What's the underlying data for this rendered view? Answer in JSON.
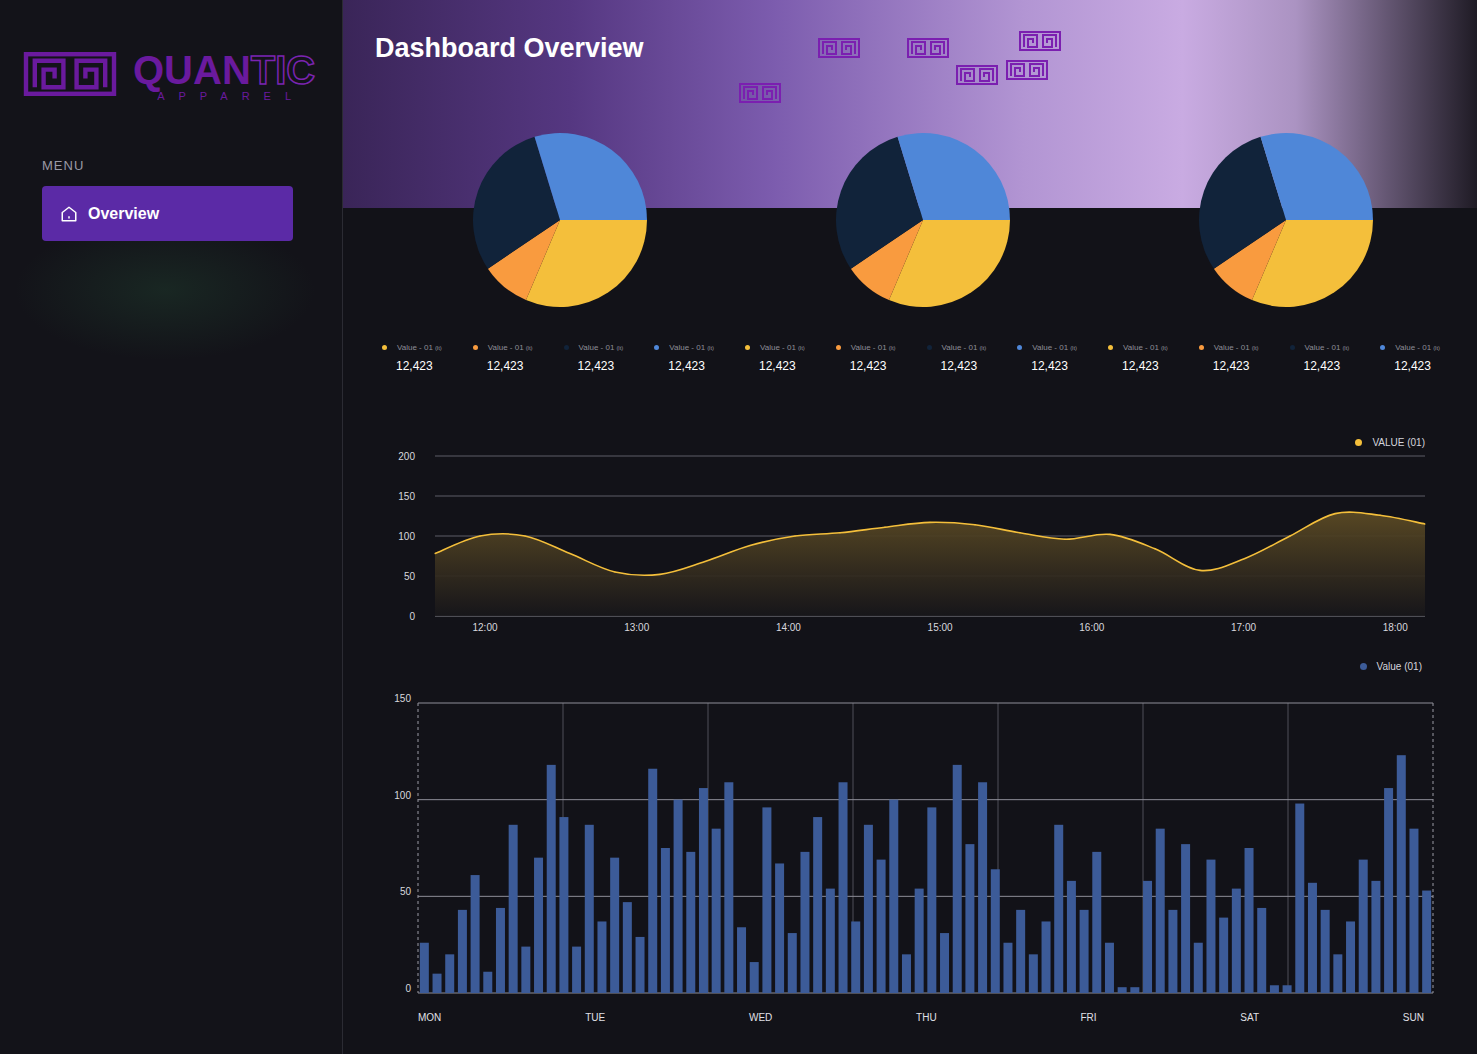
{
  "logo": {
    "name_main": "QUAN",
    "name_accent": "TIC",
    "tagline": "APPAREL"
  },
  "sidebar": {
    "section_label": "MENU",
    "items": [
      {
        "label": "Overview",
        "selected": true
      }
    ]
  },
  "header": {
    "title": "Dashboard Overview"
  },
  "pies": [
    {
      "slices": [
        {
          "label": "Value - 01",
          "unit": "(lt)",
          "value_text": "12,423",
          "share": 113,
          "color": "#f4bf3b"
        },
        {
          "label": "Value - 01",
          "unit": "(lt)",
          "value_text": "12,423",
          "share": 33,
          "color": "#f99b3f"
        },
        {
          "label": "Value - 01",
          "unit": "(lt)",
          "value_text": "12,423",
          "share": 107,
          "color": "#11233a"
        },
        {
          "label": "Value - 01",
          "unit": "(lt)",
          "value_text": "12,423",
          "share": 107,
          "color": "#4f87d8"
        }
      ]
    },
    {
      "slices": [
        {
          "label": "Value - 01",
          "unit": "(lt)",
          "value_text": "12,423",
          "share": 113,
          "color": "#f4bf3b"
        },
        {
          "label": "Value - 01",
          "unit": "(lt)",
          "value_text": "12,423",
          "share": 33,
          "color": "#f99b3f"
        },
        {
          "label": "Value - 01",
          "unit": "(lt)",
          "value_text": "12,423",
          "share": 107,
          "color": "#11233a"
        },
        {
          "label": "Value - 01",
          "unit": "(lt)",
          "value_text": "12,423",
          "share": 107,
          "color": "#4f87d8"
        }
      ]
    },
    {
      "slices": [
        {
          "label": "Value - 01",
          "unit": "(lt)",
          "value_text": "12,423",
          "share": 113,
          "color": "#f4bf3b"
        },
        {
          "label": "Value - 01",
          "unit": "(lt)",
          "value_text": "12,423",
          "share": 33,
          "color": "#f99b3f"
        },
        {
          "label": "Value - 01",
          "unit": "(lt)",
          "value_text": "12,423",
          "share": 107,
          "color": "#11233a"
        },
        {
          "label": "Value - 01",
          "unit": "(lt)",
          "value_text": "12,423",
          "share": 107,
          "color": "#4f87d8"
        }
      ]
    }
  ],
  "line_chart": {
    "legend": "VALUE (01)",
    "y_ticks": [
      "200",
      "150",
      "100",
      "50",
      "0"
    ],
    "x_ticks": [
      "12:00",
      "13:00",
      "14:00",
      "15:00",
      "16:00",
      "17:00",
      "18:00"
    ],
    "values": [
      78,
      100,
      100,
      78,
      55,
      52,
      68,
      88,
      100,
      104,
      111,
      117,
      114,
      104,
      96,
      102,
      84,
      57,
      72,
      100,
      128,
      126,
      115
    ]
  },
  "bar_chart": {
    "legend": "Value (01)",
    "y_ticks": [
      "150",
      "100",
      "50",
      "0"
    ],
    "x_ticks": [
      "MON",
      "TUE",
      "WED",
      "THU",
      "FRI",
      "SAT",
      "SUN"
    ],
    "values": [
      26,
      10,
      20,
      43,
      61,
      11,
      44,
      87,
      24,
      70,
      118,
      91,
      24,
      87,
      37,
      70,
      47,
      29,
      116,
      75,
      100,
      73,
      106,
      85,
      109,
      34,
      16,
      96,
      67,
      31,
      73,
      91,
      54,
      109,
      37,
      87,
      69,
      100,
      20,
      54,
      96,
      31,
      118,
      77,
      109,
      64,
      26,
      43,
      20,
      37,
      87,
      58,
      43,
      73,
      26,
      3,
      3,
      58,
      85,
      43,
      77,
      26,
      69,
      39,
      54,
      75,
      44,
      4,
      4,
      98,
      57,
      43,
      20,
      37,
      69,
      58,
      106,
      123,
      85,
      53
    ]
  }
}
